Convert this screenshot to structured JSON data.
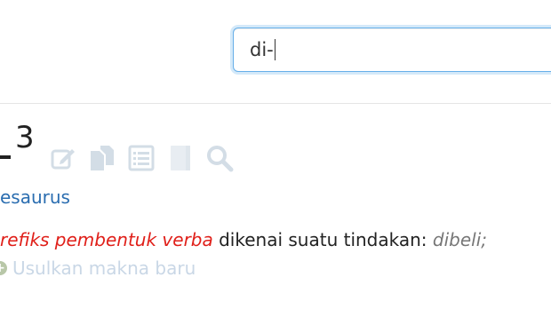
{
  "search": {
    "value": "di-"
  },
  "entry": {
    "superscript": "3"
  },
  "toolbar": {
    "icons": [
      "edit-icon",
      "copy-icon",
      "list-icon",
      "document-icon",
      "search-icon"
    ],
    "color": "#d3dde6"
  },
  "links": {
    "tesaurus": "esaurus"
  },
  "definition": {
    "category": "refiks pembentuk verba",
    "text": " dikenai suatu tindakan: ",
    "example": "dibeli;"
  },
  "suggest": {
    "label": "Usulkan makna baru"
  }
}
